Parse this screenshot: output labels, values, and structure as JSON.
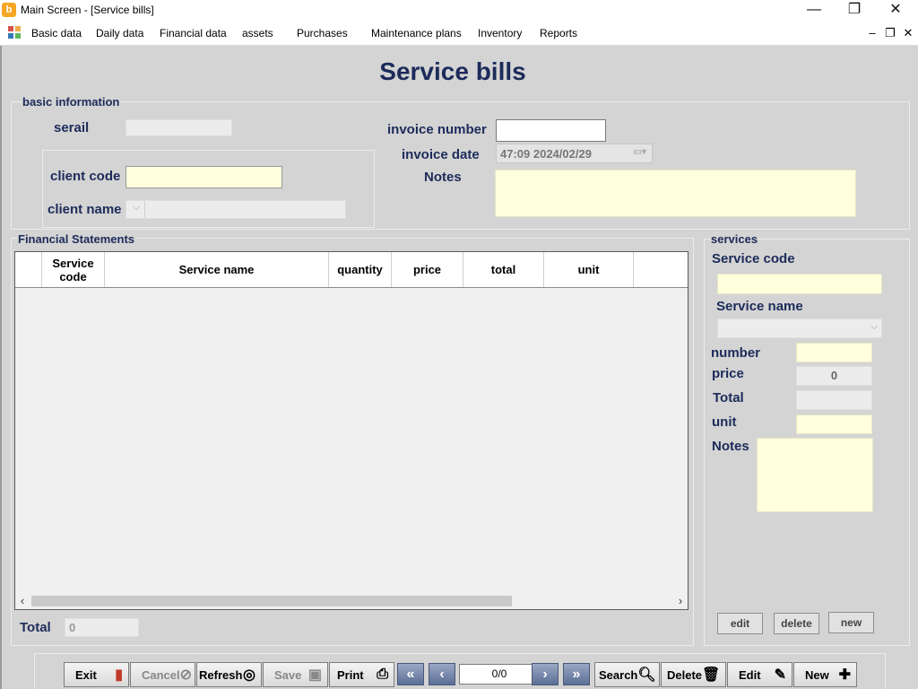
{
  "window": {
    "title": "Main Screen - [Service bills]",
    "minimize": "—",
    "maximize": "❐",
    "close": "✕"
  },
  "menu": {
    "items": [
      "Basic data",
      "Daily data",
      "Financial data",
      "assets",
      "Purchases",
      "Maintenance plans",
      "Inventory",
      "Reports"
    ],
    "mdi_minimize": "–",
    "mdi_restore": "❐",
    "mdi_close": "✕"
  },
  "page_title": "Service bills",
  "basic_info": {
    "group_label": "basic information",
    "serial_label": "serail",
    "serial_value": "",
    "client_code_label": "client code",
    "client_code_value": "",
    "client_name_label": "client name",
    "client_name_value": "",
    "invoice_number_label": "invoice number",
    "invoice_number_value": "",
    "invoice_date_label": "invoice date",
    "invoice_date_value": "47:09 2024/02/29",
    "notes_label": "Notes",
    "notes_value": ""
  },
  "statements": {
    "group_label": "Financial Statements",
    "columns": [
      "Service code",
      "Service name",
      "quantity",
      "price",
      "total",
      "unit"
    ],
    "rows": [],
    "total_label": "Total",
    "total_value": "0"
  },
  "services": {
    "group_label": "services",
    "service_code_label": "Service code",
    "service_code_value": "",
    "service_name_label": "Service name",
    "service_name_value": "",
    "number_label": "number",
    "number_value": "",
    "price_label": "price",
    "price_value": "0",
    "total_label": "Total",
    "total_value": "",
    "unit_label": "unit",
    "unit_value": "",
    "notes_label": "Notes",
    "notes_value": "",
    "edit_label": "edit",
    "delete_label": "delete",
    "new_label": "new"
  },
  "toolbar": {
    "exit": "Exit",
    "cancel": "Cancel",
    "refresh": "Refresh",
    "save": "Save",
    "print": "Print",
    "first": "«",
    "prev": "‹",
    "pager": "0/0",
    "next": "›",
    "last": "»",
    "search": "Search",
    "delete": "Delete",
    "edit": "Edit",
    "new": "New"
  },
  "colors": {
    "title_text": "#1c2b5a",
    "panel_bg": "#d4d4d4",
    "input_yellow": "#ffffdd",
    "nav_button": "#5b6e96"
  }
}
